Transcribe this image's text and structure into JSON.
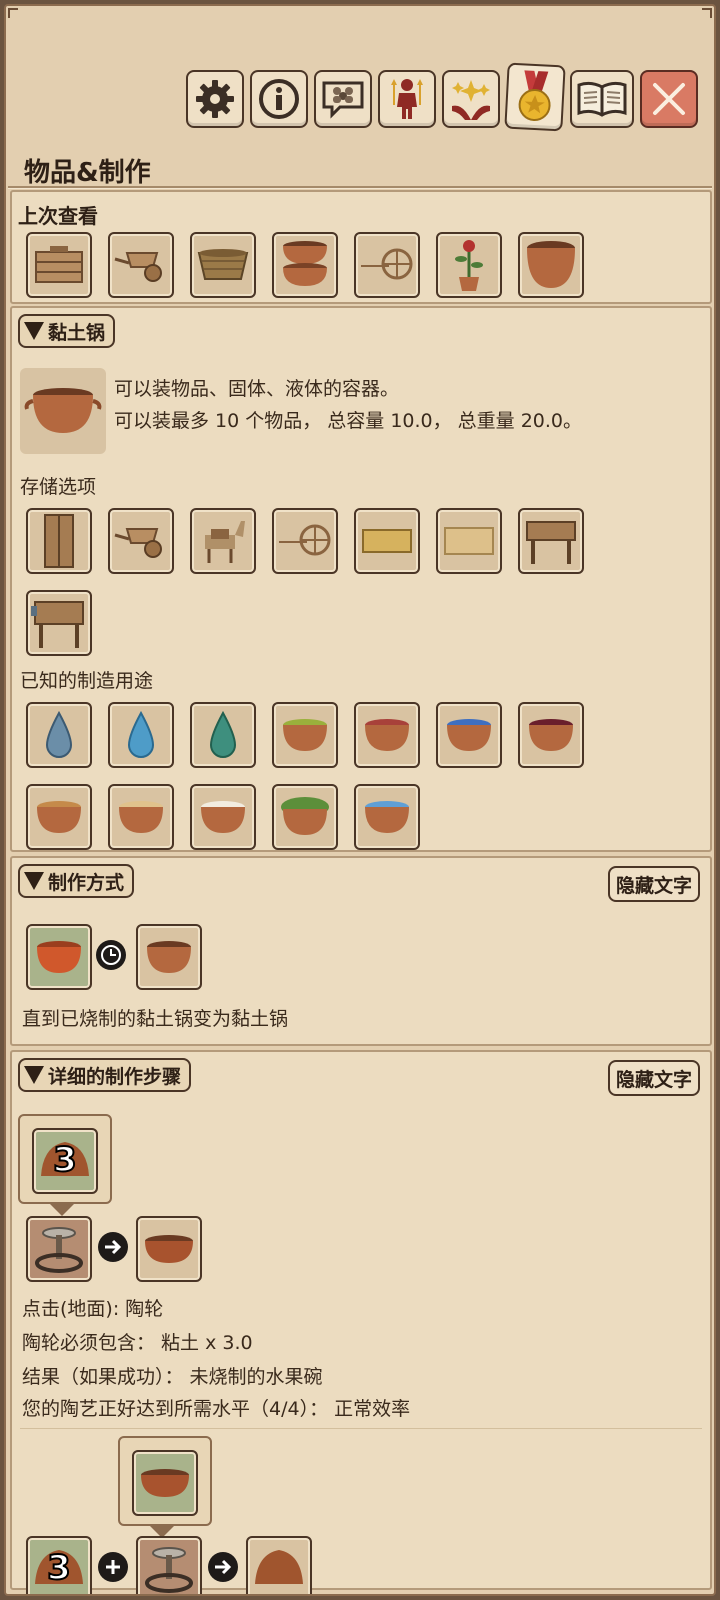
{
  "window": {
    "title": "物品&制作"
  },
  "toolbar": {
    "buttons": [
      {
        "icon": "gear-icon"
      },
      {
        "icon": "info-icon"
      },
      {
        "icon": "speech-people-icon"
      },
      {
        "icon": "character-icon"
      },
      {
        "icon": "sparkle-hands-icon"
      },
      {
        "icon": "medal-icon"
      },
      {
        "icon": "book-icon"
      },
      {
        "icon": "close-icon"
      }
    ]
  },
  "recent": {
    "label": "上次查看",
    "items": [
      "wooden-crate-icon",
      "wheelbarrow-icon",
      "basket-icon",
      "stacked-pots-icon",
      "cart-icon",
      "potted-rose-icon",
      "clay-bowl-icon"
    ]
  },
  "item": {
    "name": "黏土锅",
    "desc_line1": "可以装物品、固体、液体的容器。",
    "desc_line2": "可以装最多 10 个物品， 总容量 10.0， 总重量 20.0。"
  },
  "storage": {
    "label": "存储选项",
    "items": [
      "wardrobe-icon",
      "wheelbarrow-icon",
      "llama-packs-icon",
      "cart-icon",
      "straw-mat-icon",
      "woven-rug-icon",
      "table-icon",
      "workbench-icon"
    ]
  },
  "uses": {
    "label": "已知的制造用途",
    "items": [
      "water-drop-gray-icon",
      "water-drop-blue-icon",
      "water-drop-green-icon",
      "pot-green-food-icon",
      "pot-red-berries-icon",
      "pot-blue-berries-icon",
      "pot-dark-berries-icon",
      "pot-stew-icon",
      "pot-grain-icon",
      "pot-milk-icon",
      "pot-leaves-icon",
      "pot-water-icon"
    ]
  },
  "method": {
    "label": "制作方式",
    "hide_label": "隐藏文字",
    "description": "直到已烧制的黏土锅变为黏土锅"
  },
  "steps": {
    "label": "详细的制作步骤",
    "hide_label": "隐藏文字",
    "clay_count": "3",
    "line1": "点击(地面): 陶轮",
    "line2": "陶轮必须包含：  粘土 x 3.0",
    "line3": "结果（如果成功）：  未烧制的水果碗",
    "line4": "您的陶艺正好达到所需水平（4/4）：  正常效率",
    "next_count": "3"
  },
  "colors": {
    "parchment": "#e3cfb0",
    "panel": "#ecdcc0",
    "border": "#4a3526",
    "close": "#d97a64",
    "clay": "#b4683f"
  }
}
